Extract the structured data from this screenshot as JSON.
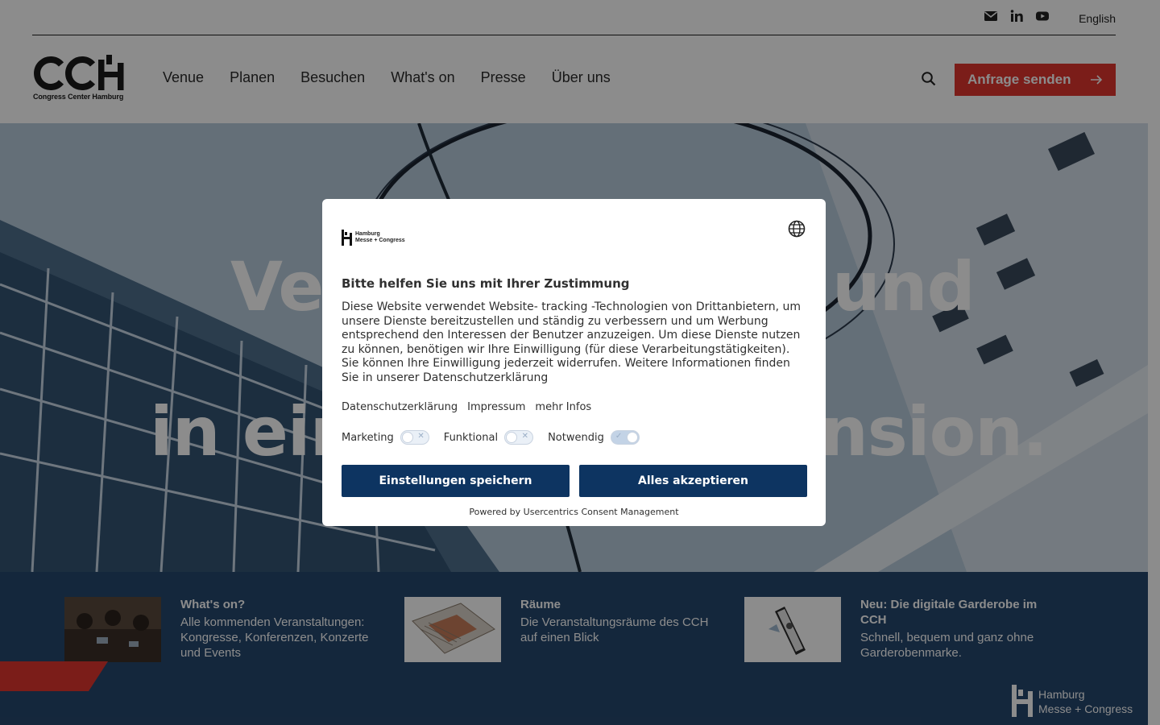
{
  "header": {
    "language": "English",
    "logo_text": "CCH",
    "logo_subtitle": "Congress Center Hamburg",
    "nav": [
      "Venue",
      "Planen",
      "Besuchen",
      "What's on",
      "Presse",
      "Über uns"
    ],
    "cta_label": "Anfrage senden",
    "social_icons": [
      "mail-icon",
      "linkedin-icon",
      "youtube-icon"
    ]
  },
  "hero": {
    "line1_left": "Ver",
    "line1_right": "und",
    "line2_left": "in ein",
    "line2_right": "nsion."
  },
  "teasers": [
    {
      "title": "What's on?",
      "description": "Alle kommenden Veranstaltungen: Kongresse, Konferenzen, Konzerte und Events"
    },
    {
      "title": "Räume",
      "description": "Die Veranstaltungsräume des CCH auf einen Blick"
    },
    {
      "title": "Neu: Die digitale Garderobe im CCH",
      "description": "Schnell, bequem und ganz ohne Garderobenmarke."
    }
  ],
  "footer_logo": {
    "line1": "Hamburg",
    "line2": "Messe + Congress"
  },
  "consent": {
    "logo_line1": "Hamburg",
    "logo_line2": "Messe + Congress",
    "title": "Bitte helfen Sie uns mit Ihrer Zustimmung",
    "body": "Diese Website verwendet Website- tracking -Technologien von Drittanbietern, um unsere Dienste bereitzustellen und ständig zu verbessern und um Werbung entsprechend den Interessen der Benutzer anzuzeigen. Um diese Dienste nutzen zu können, benötigen wir Ihre Einwilligung (für diese Verarbeitungstätigkeiten). Sie können Ihre Einwilligung jederzeit widerrufen. Weitere Informationen finden Sie in unserer Datenschutzerklärung",
    "links": [
      "Datenschutzerklärung",
      "Impressum",
      "mehr Infos"
    ],
    "toggles": [
      {
        "label": "Marketing",
        "on": false
      },
      {
        "label": "Funktional",
        "on": false
      },
      {
        "label": "Notwendig",
        "on": true
      }
    ],
    "save_label": "Einstellungen speichern",
    "accept_label": "Alles akzeptieren",
    "powered_by": "Powered by Usercentrics Consent Management"
  },
  "colors": {
    "accent_red": "#e0362f",
    "band_blue": "#26476e",
    "consent_button": "#0d3461"
  }
}
